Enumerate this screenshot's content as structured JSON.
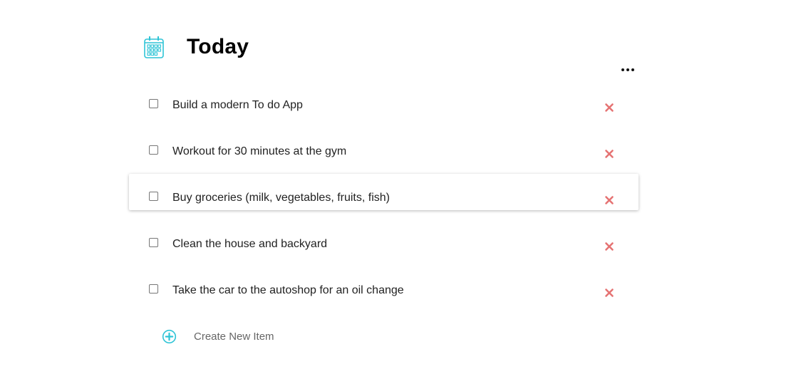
{
  "header": {
    "title": "Today",
    "icon": "calendar-icon",
    "more_icon": "more-horizontal-icon"
  },
  "todos": [
    {
      "text": "Build a modern To do App",
      "checked": false
    },
    {
      "text": "Workout for 30 minutes at the gym",
      "checked": false
    },
    {
      "text": "Buy groceries (milk, vegetables, fruits, fish)",
      "checked": false
    },
    {
      "text": "Clean the house and backyard",
      "checked": false
    },
    {
      "text": "Take the car to the autoshop for an oil change",
      "checked": false
    }
  ],
  "create": {
    "label": "Create New Item",
    "icon": "plus-circle-icon"
  },
  "colors": {
    "accent": "#2ec4d6",
    "delete": "#e57373",
    "title": "#000000"
  }
}
